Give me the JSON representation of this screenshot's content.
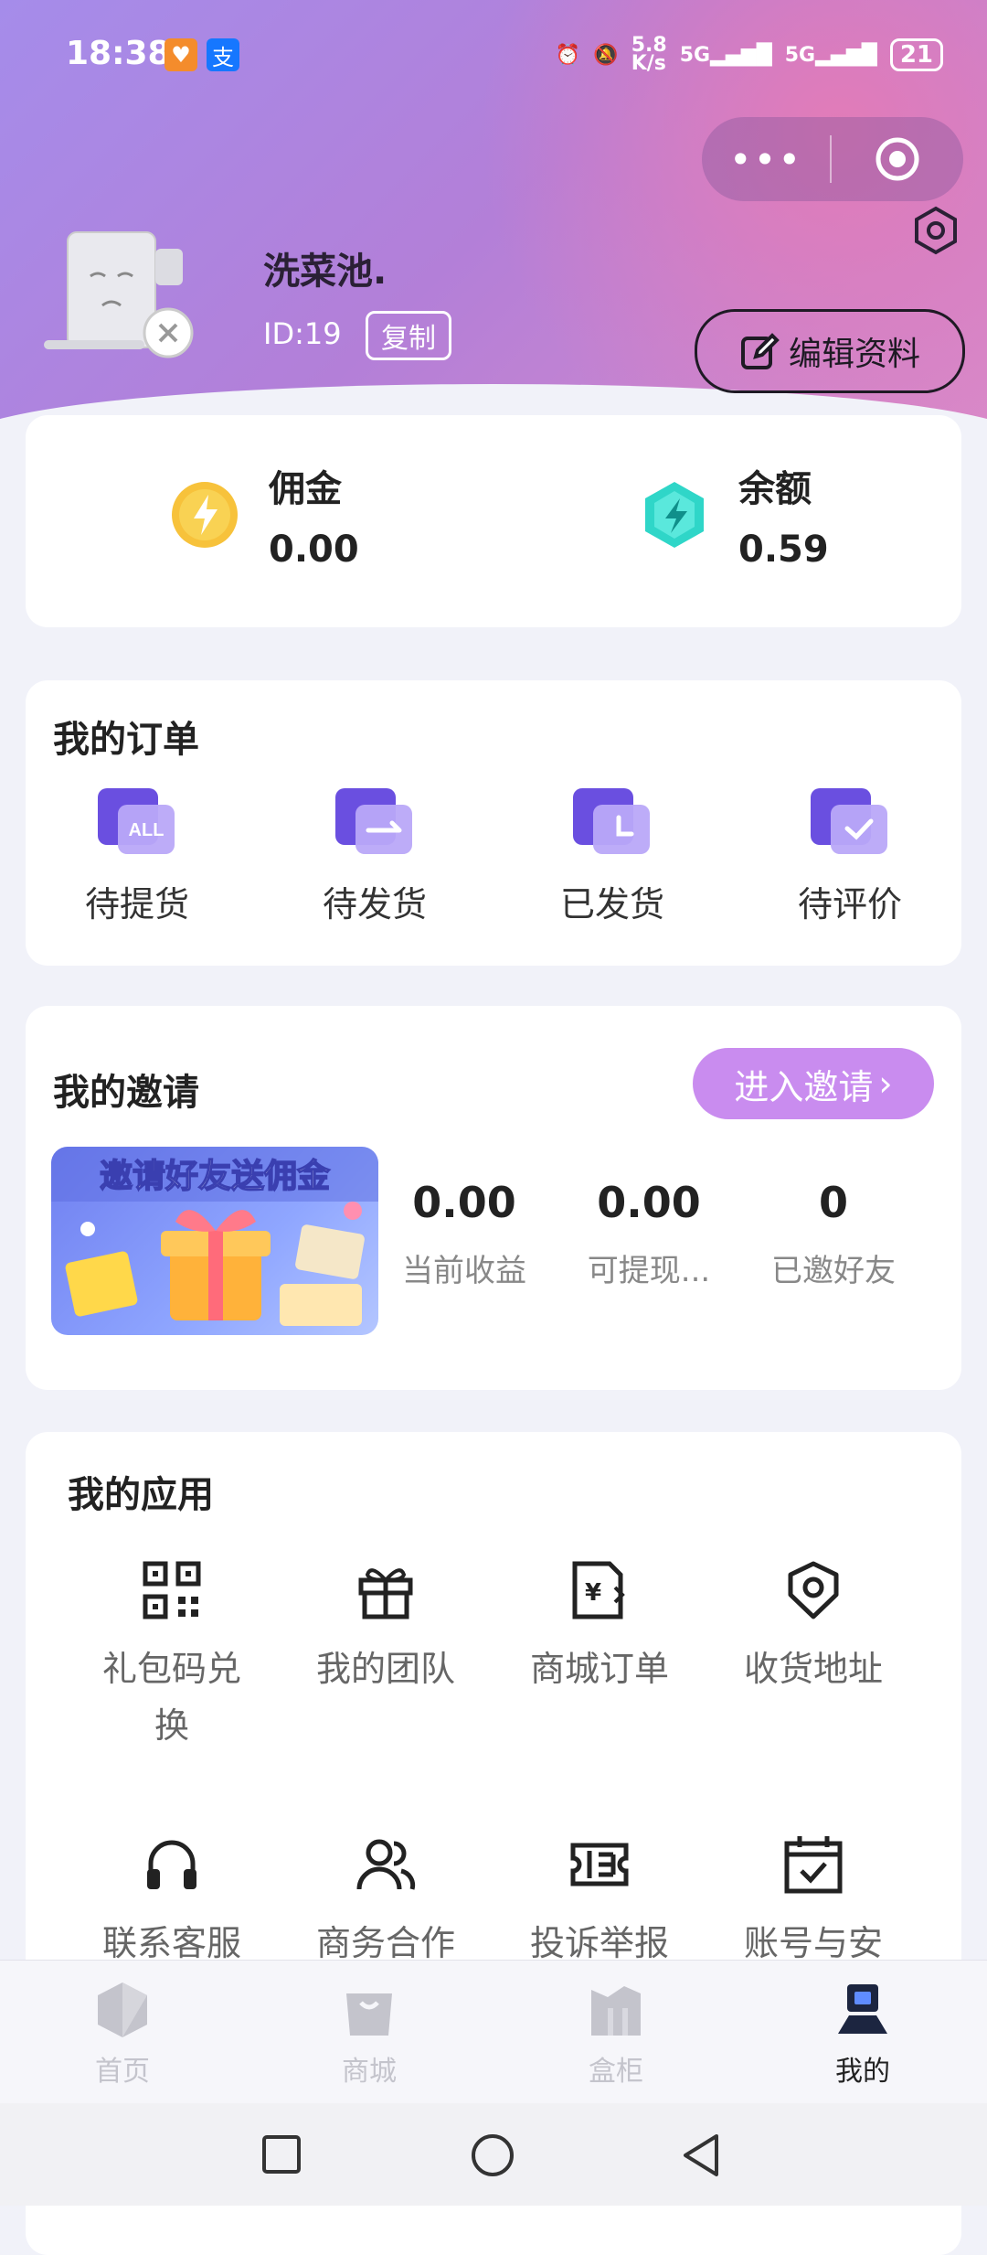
{
  "status_bar": {
    "time": "18:38",
    "net_speed_value": "5.8",
    "net_speed_unit": "K/s",
    "signal1": "5G",
    "signal2": "5G",
    "battery": "21"
  },
  "profile": {
    "username": "洗菜池.",
    "id_text": "ID:19",
    "copy_label": "复制",
    "edit_label": "编辑资料"
  },
  "wallet": {
    "commission": {
      "label": "佣金",
      "value": "0.00"
    },
    "balance": {
      "label": "余额",
      "value": "0.59"
    }
  },
  "orders": {
    "title": "我的订单",
    "items": [
      {
        "label": "待提货",
        "icon": "all-orders-icon",
        "badge": "ALL"
      },
      {
        "label": "待发货",
        "icon": "pending-ship-icon"
      },
      {
        "label": "已发货",
        "icon": "shipped-icon"
      },
      {
        "label": "待评价",
        "icon": "review-icon"
      }
    ]
  },
  "invite": {
    "title": "我的邀请",
    "button_label": "进入邀请",
    "banner_text": "邀请好友送佣金",
    "stats": [
      {
        "value": "0.00",
        "label": "当前收益"
      },
      {
        "value": "0.00",
        "label": "可提现..."
      },
      {
        "value": "0",
        "label": "已邀好友"
      }
    ]
  },
  "apps": {
    "title": "我的应用",
    "items": [
      {
        "label": "礼包码兑换",
        "icon": "qr-code-icon"
      },
      {
        "label": "我的团队",
        "icon": "gift-icon"
      },
      {
        "label": "商城订单",
        "icon": "mall-order-icon"
      },
      {
        "label": "收货地址",
        "icon": "location-icon"
      },
      {
        "label": "联系客服",
        "icon": "headset-icon"
      },
      {
        "label": "商务合作",
        "icon": "users-icon"
      },
      {
        "label": "投诉举报",
        "icon": "ticket-icon"
      },
      {
        "label": "账号与安",
        "icon": "calendar-check-icon"
      }
    ]
  },
  "tabbar": {
    "items": [
      {
        "label": "首页",
        "icon": "home-icon"
      },
      {
        "label": "商城",
        "icon": "shop-bag-icon"
      },
      {
        "label": "盒柜",
        "icon": "cabinet-icon"
      },
      {
        "label": "我的",
        "icon": "profile-icon",
        "active": true
      }
    ]
  },
  "colors": {
    "accent": "#c98cef",
    "header_start": "#a58cea",
    "header_end": "#d98ac9",
    "order_icon": "#7b5de6"
  }
}
